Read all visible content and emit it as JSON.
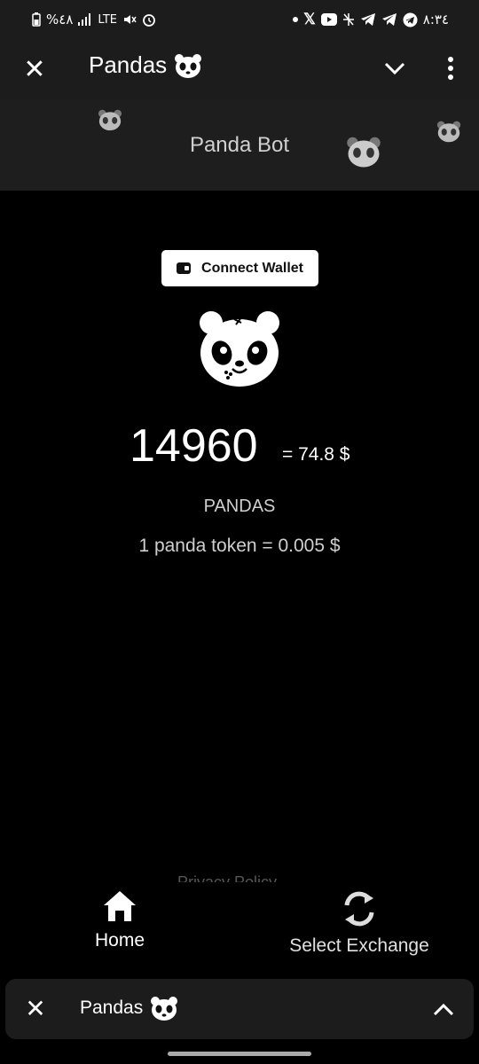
{
  "status_bar": {
    "left_text": "%٤٨",
    "network": "LTE",
    "time": "٨:٣٤"
  },
  "header": {
    "title": "Pandas",
    "close_icon": "close-icon",
    "chevron_icon": "chevron-down-icon",
    "more_icon": "more-vertical-icon"
  },
  "banner": {
    "title": "Panda Bot"
  },
  "main": {
    "connect_wallet_label": "Connect Wallet",
    "balance": "14960",
    "usd_value": "= 74.8 $",
    "token_name": "PANDAS",
    "token_rate": "1 panda token = 0.005 $",
    "faded_text": "Privacy Policy"
  },
  "bottom_nav": {
    "items": [
      {
        "label": "Home",
        "icon": "home-icon",
        "active": true
      },
      {
        "label": "Select Exchange",
        "icon": "exchange-icon",
        "active": false
      }
    ]
  },
  "mini_bar": {
    "title": "Pandas"
  },
  "colors": {
    "background": "#000000",
    "header_bg": "#1c1c1c",
    "banner_bg": "#1e1e1e",
    "text_secondary": "#cfcfcf"
  }
}
